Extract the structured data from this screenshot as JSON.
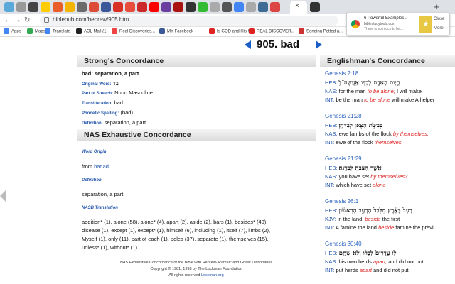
{
  "browser": {
    "tab_colors": [
      "#5aa9d8",
      "#999999",
      "#444444",
      "#ffcc00",
      "#e85d2a",
      "#f4b400",
      "#6b6b6b",
      "#dd4b39",
      "#3b5998",
      "#d93025",
      "#e74c3c",
      "#cc2a2a",
      "#ff0000",
      "#6b3fa0",
      "#a11",
      "#333333",
      "#33bb33",
      "#aaa",
      "#555",
      "#4285f4",
      "#aaaaaa",
      "#3f6c95",
      "#d44",
      "#333"
    ],
    "active_tab_close": "×",
    "new_tab": "+",
    "url": "biblehub.com/hebrew/905.htm",
    "bookmarks": [
      {
        "label": "Apps",
        "color": "#4285f4"
      },
      {
        "label": "Maps",
        "color": "#34a853"
      },
      {
        "label": "Translate",
        "color": "#4285f4"
      },
      {
        "label": "AOL Mail (1)",
        "color": "#222222"
      },
      {
        "label": "Real Discoveries...",
        "color": "#e44"
      },
      {
        "label": "MY Facebook",
        "color": "#3b5998"
      },
      {
        "label": "Is GOD and His S...",
        "color": "#dd2222"
      },
      {
        "label": "REAL DISCOVER...",
        "color": "#dd2222"
      },
      {
        "label": "Sending Potted a...",
        "color": "#cc3333"
      }
    ]
  },
  "notification": {
    "title": "6 Powerful Examples...",
    "site": "biblestudytools.com",
    "body": "There is so much to be...",
    "close": "Close",
    "more": "More"
  },
  "heading": {
    "title": "905. bad"
  },
  "strongs": {
    "header": "Strong's Concordance",
    "gloss": "bad: separation, a part",
    "original_word_label": "Original Word:",
    "original_word": "בַּד",
    "pos_label": "Part of Speech:",
    "pos": "Noun Masculine",
    "translit_label": "Transliteration:",
    "translit": "bad",
    "phonetic_label": "Phonetic Spelling:",
    "phonetic": "(bad)",
    "definition_label": "Definition:",
    "definition": "separation, a part"
  },
  "nas": {
    "header": "NAS Exhaustive Concordance",
    "word_origin_label": "Word Origin",
    "word_origin_prefix": "from",
    "word_origin_link": "badad",
    "definition_label": "Definition",
    "definition": "separation, a part",
    "nasb_label": "NASB Translation",
    "translation_lines": [
      "addition* (1), alone (58), alone* (4), apart (2), aside (2), bars (1), besides* (40),",
      "disease (1), except (1), except* (1), himself (6), including (1), itself (7), limbs (2),",
      "Myself (1), only (11), part of each (1), poles (37), separate (1), themselves (15),",
      "unless* (1), without* (1)."
    ],
    "footer_lines": [
      "NAS Exhaustive Concordance of the Bible with Hebrew-Aramaic and Greek Dictionaries",
      "Copyright © 1981, 1998 by The Lockman Foundation",
      "All rights reserved"
    ],
    "footer_link": "Lockman.org"
  },
  "englishman": {
    "header": "Englishman's Concordance",
    "entries": [
      {
        "ref": "Genesis 2:18",
        "heb_label": "HEB:",
        "heb": "הֱיֹ֥ות הָאָדָ֖ם לְבַדֹּ֑ו אֶֽעֱשֶׂהּ־לֹּ֥",
        "l2_label": "NAS:",
        "l2_pre": "for the man",
        "l2_red": "to be alone;",
        "l2_post": "I will make",
        "l3_label": "INT:",
        "l3_pre": "be the man",
        "l3_red": "to be alone",
        "l3_post": "will make A helper"
      },
      {
        "ref": "Genesis 21:28",
        "heb_label": "HEB:",
        "heb": "כִּבְשֹׂ֥ת הַצֹּ֖אן לְבַדְּהֶֽן׃",
        "l2_label": "NAS:",
        "l2_pre": "ewe lambs of the flock",
        "l2_red": "by themselves.",
        "l2_post": "",
        "l3_label": "INT:",
        "l3_pre": "ewe of the flock",
        "l3_red": "themselves",
        "l3_post": ""
      },
      {
        "ref": "Genesis 21:29",
        "heb_label": "HEB:",
        "heb": "אֲשֶׁ֣ר הִצַּ֔בְתָּ לְבַדָּֽנָה׃",
        "l2_label": "NAS:",
        "l2_pre": "you have set",
        "l2_red": "by themselves?",
        "l2_post": "",
        "l3_label": "INT:",
        "l3_pre": "which have set",
        "l3_red": "alone",
        "l3_post": ""
      },
      {
        "ref": "Genesis 26:1",
        "heb_label": "HEB:",
        "heb": "רָעָב֙ בָּאָ֔רֶץ מִלְּבַד֙ הָרָעָ֣ב הָרִאשֹׁ֔ון",
        "l2_label": "KJV:",
        "l2_pre": "in the land,",
        "l2_red": "beside",
        "l2_post": "the first",
        "l3_label": "INT:",
        "l3_pre": "A famine the land",
        "l3_red": "beside",
        "l3_post": "famine the previ"
      },
      {
        "ref": "Genesis 30:40",
        "heb_label": "HEB:",
        "heb": "לֹּ֤ו עֲדָרִים֙ לְבַדֹּ֔ו וְלֹ֥א שָׁתָ֖ם",
        "l2_label": "NAS:",
        "l2_pre": "his own herds",
        "l2_red": "apart,",
        "l2_post": "and did not put",
        "l3_label": "INT:",
        "l3_pre": "put herds",
        "l3_red": "apart",
        "l3_post": "and did not put"
      }
    ]
  }
}
